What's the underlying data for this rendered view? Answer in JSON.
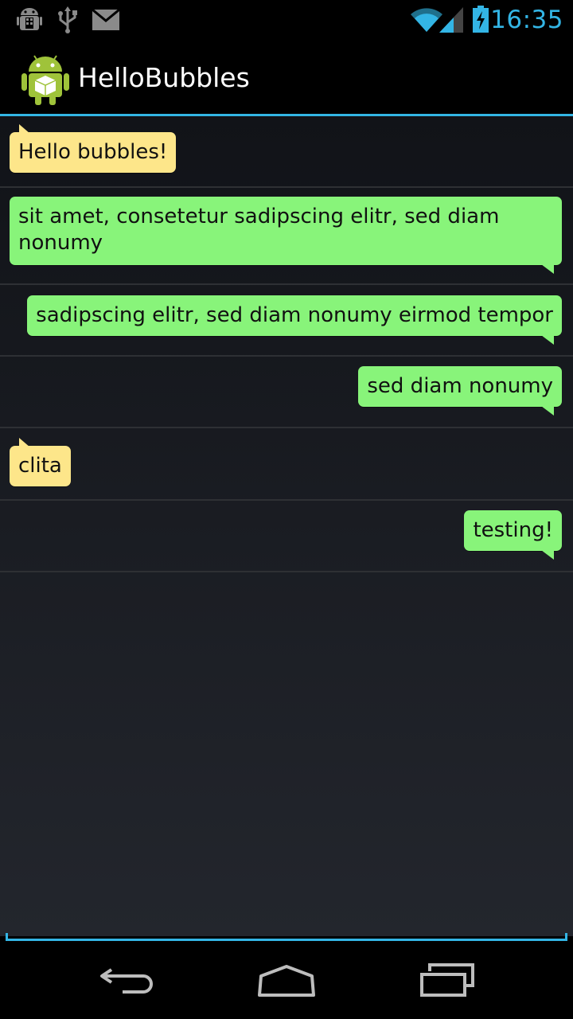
{
  "status_bar": {
    "time": "16:35",
    "icons": [
      "android-debug-icon",
      "usb-icon",
      "mail-icon",
      "wifi-icon",
      "signal-icon",
      "battery-charging-icon"
    ],
    "accent_color": "#33b5e5"
  },
  "action_bar": {
    "title": "HelloBubbles",
    "icon": "android-app-icon"
  },
  "messages": [
    {
      "text": "Hello bubbles!",
      "side": "left",
      "color": "#fde68a"
    },
    {
      "text": "sit amet, consetetur sadipscing elitr, sed diam nonumy",
      "side": "right",
      "color": "#88f47a"
    },
    {
      "text": "sadipscing elitr, sed diam nonumy eirmod tempor",
      "side": "right",
      "color": "#88f47a"
    },
    {
      "text": "sed diam nonumy",
      "side": "right",
      "color": "#88f47a"
    },
    {
      "text": "clita",
      "side": "left",
      "color": "#fde68a"
    },
    {
      "text": "testing!",
      "side": "right",
      "color": "#88f47a"
    }
  ],
  "nav_bar": {
    "buttons": [
      "back-icon",
      "home-icon",
      "recent-apps-icon"
    ]
  }
}
